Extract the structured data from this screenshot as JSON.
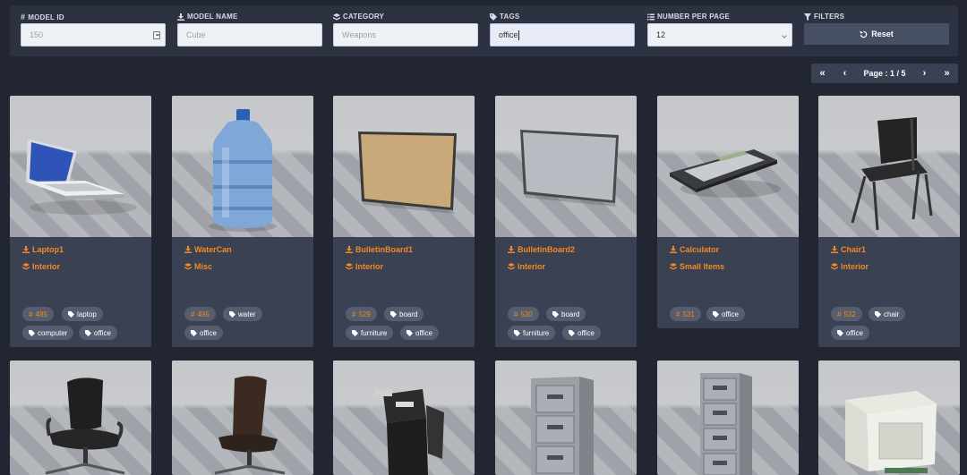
{
  "filters": {
    "model_id": {
      "label": "MODEL ID",
      "placeholder": "150",
      "value": ""
    },
    "model_name": {
      "label": "MODEL NAME",
      "placeholder": "Cube",
      "value": ""
    },
    "category": {
      "label": "CATEGORY",
      "placeholder": "Weapons",
      "value": ""
    },
    "tags": {
      "label": "TAGS",
      "placeholder": "",
      "value": "office"
    },
    "per_page": {
      "label": "NUMBER PER PAGE",
      "value": "12"
    },
    "filters": {
      "label": "FILTERS",
      "reset_label": "Reset"
    }
  },
  "pagination": {
    "label": "Page : 1 / 5"
  },
  "accent_color": "#f08a24",
  "cards": [
    {
      "name": "Laptop1",
      "category": "Interior",
      "id": "485",
      "tags": [
        "laptop",
        "computer",
        "office"
      ],
      "image": "laptop"
    },
    {
      "name": "WaterCan",
      "category": "Misc",
      "id": "495",
      "tags": [
        "water",
        "office"
      ],
      "image": "water-bottle"
    },
    {
      "name": "BulletinBoard1",
      "category": "Interior",
      "id": "529",
      "tags": [
        "board",
        "furniture",
        "office"
      ],
      "image": "cork-board"
    },
    {
      "name": "BulletinBoard2",
      "category": "Interior",
      "id": "530",
      "tags": [
        "board",
        "furniture",
        "office"
      ],
      "image": "white-board"
    },
    {
      "name": "Calculator",
      "category": "Small Items",
      "id": "531",
      "tags": [
        "office"
      ],
      "image": "calculator"
    },
    {
      "name": "Chair1",
      "category": "Interior",
      "id": "532",
      "tags": [
        "chair",
        "office"
      ],
      "image": "chair"
    },
    {
      "image": "office-chair"
    },
    {
      "image": "leather-chair"
    },
    {
      "image": "printer"
    },
    {
      "image": "filing-cabinet"
    },
    {
      "image": "tall-filing-cabinet"
    },
    {
      "image": "crt-monitor"
    }
  ]
}
